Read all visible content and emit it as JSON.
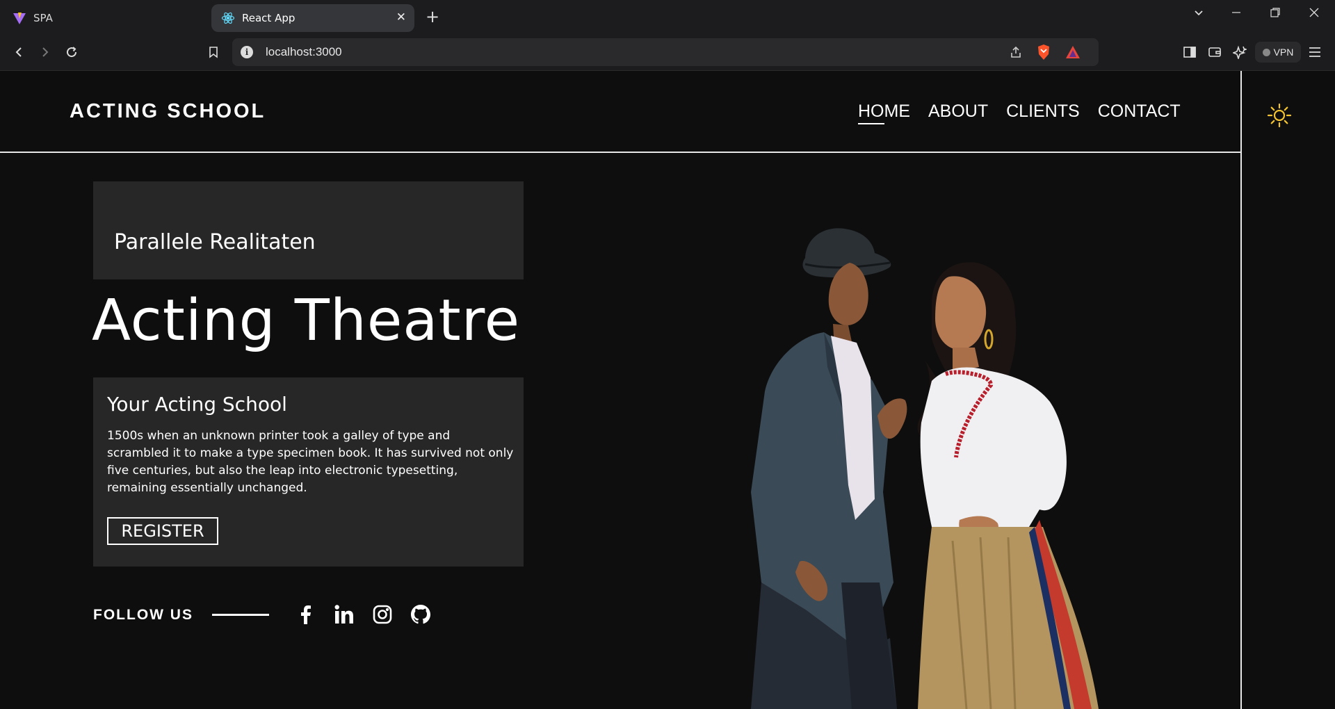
{
  "browser": {
    "tabs": [
      {
        "title": "SPA",
        "active": false
      },
      {
        "title": "React App",
        "active": true
      }
    ],
    "url": "localhost:3000",
    "vpn_label": "VPN"
  },
  "site": {
    "logo": "ACTING SCHOOL",
    "nav": [
      {
        "label": "HOME",
        "active": true
      },
      {
        "label": "ABOUT",
        "active": false
      },
      {
        "label": "CLIENTS",
        "active": false
      },
      {
        "label": "CONTACT",
        "active": false
      }
    ],
    "theme_toggle_icon": "sun-icon"
  },
  "hero": {
    "subtitle": "Parallele Realitaten",
    "title": "Acting Theatre",
    "card_heading": "Your Acting School",
    "card_text": "1500s when an unknown printer took a galley of type and scrambled it to make a type specimen book. It has survived not only five centuries, but also the leap into electronic typesetting, remaining essentially unchanged.",
    "register_label": "REGISTER",
    "follow_label": "FOLLOW US",
    "social_icons": [
      "facebook-icon",
      "linkedin-icon",
      "instagram-icon",
      "github-icon"
    ]
  },
  "colors": {
    "page_bg": "#0e0e0e",
    "card_bg": "#272727",
    "sun": "#f4c430"
  }
}
